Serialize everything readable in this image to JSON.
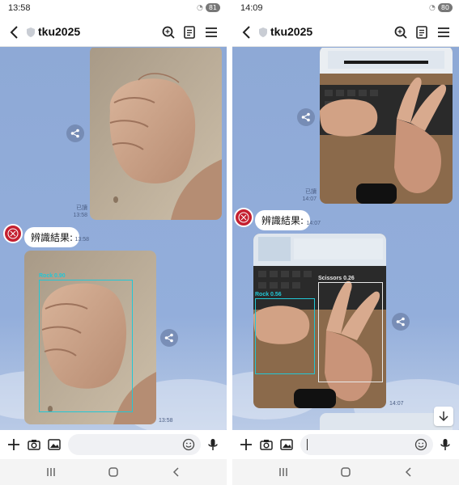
{
  "left": {
    "status_time": "13:58",
    "battery": "81",
    "chat_title": "tku2025",
    "read_label": "已讀",
    "sent_time": "13:58",
    "bot_time": "13:58",
    "bot_message": "辨識結果:",
    "result_time": "13:58",
    "detections": [
      {
        "label": "Rock 0.90",
        "color": "#22c7d6"
      }
    ]
  },
  "right": {
    "status_time": "14:09",
    "battery": "80",
    "chat_title": "tku2025",
    "read_label": "已讀",
    "sent_time": "14:07",
    "bot_time": "14:07",
    "bot_message": "辨識結果:",
    "result_time": "14:07",
    "detections": [
      {
        "label": "Rock 0.56",
        "color": "#22c7d6"
      },
      {
        "label": "Scissors 0.26",
        "color": "#e8e8e8"
      }
    ]
  },
  "icons": [
    "back-icon",
    "shield-icon",
    "search-icon",
    "notes-icon",
    "menu-icon",
    "share-icon",
    "plus-icon",
    "camera-icon",
    "image-icon",
    "emoji-icon",
    "mic-icon",
    "scroll-down-icon",
    "recents-icon",
    "home-icon",
    "nav-back-icon"
  ],
  "colors": {
    "chat_bg": "#8eaad6",
    "avatar": "#c42030",
    "rock_box": "#22c7d6",
    "scissors_box": "#e8e8e8"
  }
}
